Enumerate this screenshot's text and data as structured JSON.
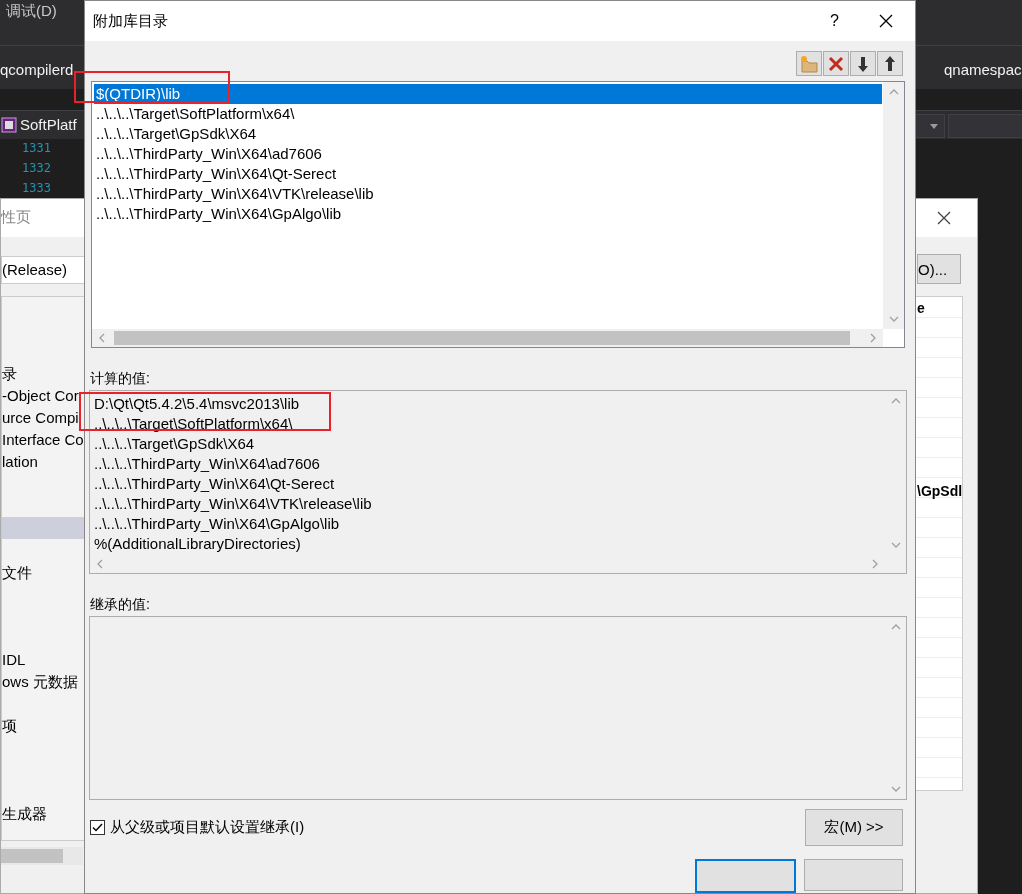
{
  "ide": {
    "menu": [
      {
        "label": "调试(D)"
      }
    ],
    "tabs": [
      {
        "label": "qcompilerd"
      },
      {
        "label": "qnamespac"
      }
    ],
    "file_tab": {
      "label": "SoftPlatf"
    },
    "line_numbers": [
      "1331",
      "1332",
      "1333"
    ]
  },
  "property_pages": {
    "title": "性页",
    "configuration": "(Release)",
    "button": "O)...",
    "tree": [
      {
        "label": "录",
        "selected": false
      },
      {
        "label": "-Object Cor",
        "selected": false
      },
      {
        "label": "urce Compi",
        "selected": false
      },
      {
        "label": "Interface Co",
        "selected": false
      },
      {
        "label": "lation",
        "selected": false
      },
      {
        "selected": true
      },
      {
        "label": "文件",
        "selected": false
      },
      {
        "label": "IDL",
        "selected": false
      },
      {
        "label": "ows 元数据",
        "selected": false
      },
      {
        "label": "项",
        "selected": false
      },
      {
        "label": "生成器",
        "selected": false
      }
    ],
    "grid_header": "e",
    "grid_value": "\\GpSdl"
  },
  "dialog": {
    "title": "附加库目录",
    "help": "?",
    "toolbar": [
      {
        "kind": "new-folder"
      },
      {
        "kind": "delete"
      },
      {
        "kind": "move-down"
      },
      {
        "kind": "move-up"
      }
    ],
    "entries": [
      {
        "text": "$(QTDIR)\\lib",
        "selected": true
      },
      {
        "text": "..\\..\\..\\Target\\SoftPlatform\\x64\\",
        "selected": false
      },
      {
        "text": "..\\..\\..\\Target\\GpSdk\\X64",
        "selected": false
      },
      {
        "text": "..\\..\\..\\ThirdParty_Win\\X64\\ad7606",
        "selected": false
      },
      {
        "text": "..\\..\\..\\ThirdParty_Win\\X64\\Qt-Serect",
        "selected": false
      },
      {
        "text": "..\\..\\..\\ThirdParty_Win\\X64\\VTK\\release\\lib",
        "selected": false
      },
      {
        "text": "..\\..\\..\\ThirdParty_Win\\X64\\GpAlgo\\lib",
        "selected": false
      }
    ],
    "evaluated_label": "计算的值:",
    "evaluated": [
      "D:\\Qt\\Qt5.4.2\\5.4\\msvc2013\\lib",
      "..\\..\\..\\Target\\SoftPlatform\\x64\\",
      "..\\..\\..\\Target\\GpSdk\\X64",
      "..\\..\\..\\ThirdParty_Win\\X64\\ad7606",
      "..\\..\\..\\ThirdParty_Win\\X64\\Qt-Serect",
      "..\\..\\..\\ThirdParty_Win\\X64\\VTK\\release\\lib",
      "..\\..\\..\\ThirdParty_Win\\X64\\GpAlgo\\lib",
      "%(AdditionalLibraryDirectories)"
    ],
    "inherited_label": "继承的值:",
    "inherit": {
      "label": "从父级或项目默认设置继承(I)",
      "checked": true
    },
    "macros_button": "宏(M) >>",
    "footer_buttons": [
      {
        "default": true
      },
      {
        "default": false
      }
    ]
  }
}
